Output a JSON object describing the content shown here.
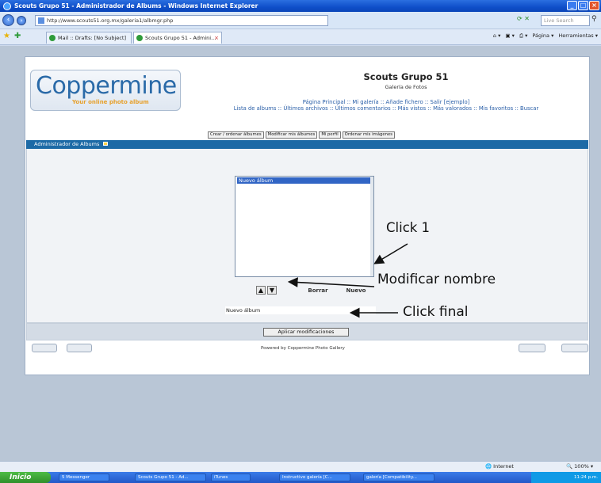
{
  "window": {
    "title": "Scouts Grupo 51 - Administrador de Albums - Windows Internet Explorer"
  },
  "browser": {
    "url": "http://www.scouts51.org.mx/galeria1/albmgr.php",
    "search_placeholder": "Live Search",
    "tabs": [
      {
        "label": "Mail :: Drafts: [No Subject]"
      },
      {
        "label": "Scouts Grupo 51 - Admini..."
      }
    ],
    "tools": {
      "page_label": "Página",
      "tools_label": "Herramientas"
    }
  },
  "site": {
    "logo_text": "Coppermine",
    "logo_tagline": "Your online photo album",
    "title": "Scouts Grupo 51",
    "subtitle": "Galería de Fotos",
    "menu_line1": "Página Principal :: Mi galería :: Añade fichero :: Salir [ejemplo]",
    "menu_line2": "Lista de albums :: Últimos archivos :: Últimos comentarios :: Más vistos :: Más valorados :: Mis favoritos :: Buscar",
    "subtabs": [
      "Crear / ordenar álbumes",
      "Modificar mis álbumes",
      "Mi perfil",
      "Ordenar mis imágenes"
    ]
  },
  "album_manager": {
    "header": "Administrador de Albums",
    "albums": [
      "Nuevo álbum"
    ],
    "up_glyph": "▲",
    "down_glyph": "▼",
    "delete_label": "Borrar",
    "new_label": "Nuevo",
    "name_value": "Nuevo álbum",
    "apply_label": "Aplicar modificaciones",
    "powered_by": "Powered by Coppermine Photo Gallery"
  },
  "annotations": {
    "click1": "Click 1",
    "rename": "Modificar nombre",
    "final": "Click  final"
  },
  "statusbar": {
    "zone": "Internet",
    "zoom": "100%"
  },
  "taskbar": {
    "start": "Inicio",
    "tasks": [
      "5 Messenger",
      "Scouts Grupo 51 - Ad...",
      "iTunes",
      "Instructivo galería [C...",
      "galería [Compatibility..."
    ],
    "clock": "11:24 p.m."
  },
  "colors": {
    "header_bar": "#1d6aa6",
    "selected_item": "#3165c5",
    "link": "#2a5fa8"
  }
}
